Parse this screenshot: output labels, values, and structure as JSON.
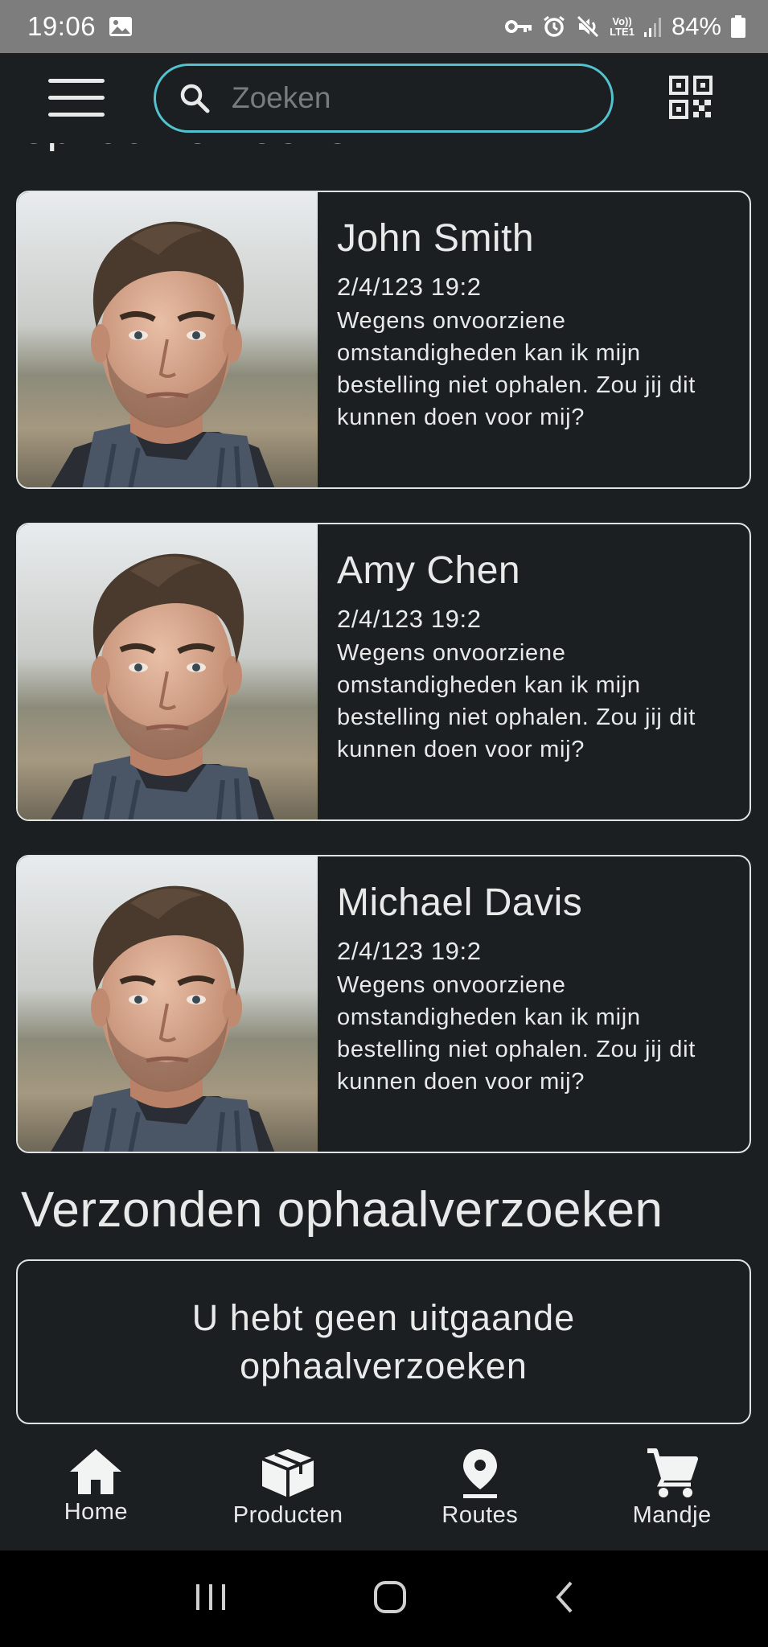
{
  "status_bar": {
    "time": "19:06",
    "battery": "84%",
    "network": "LTE1",
    "volte": "Vo))",
    "icons": [
      "gallery-icon",
      "key-icon",
      "alarm-icon",
      "mute-icon",
      "signal-icon",
      "battery-icon"
    ]
  },
  "app_bar": {
    "search_placeholder": "Zoeken",
    "icons": [
      "menu-icon",
      "search-icon",
      "qr-code-icon"
    ],
    "accent_color": "#52c2cf"
  },
  "received_heading_partial": "ophaalverzoeken",
  "requests": [
    {
      "name": "John Smith",
      "date": "2/4/123 19:2",
      "message": "Wegens onvoorziene omstandigheden kan ik mijn bestelling niet ophalen. Zou jij dit kunnen doen voor mij?"
    },
    {
      "name": "Amy Chen",
      "date": "2/4/123 19:2",
      "message": "Wegens onvoorziene omstandigheden kan ik mijn bestelling niet ophalen. Zou jij dit kunnen doen voor mij?"
    },
    {
      "name": "Michael Davis",
      "date": "2/4/123 19:2",
      "message": "Wegens onvoorziene omstandigheden kan ik mijn bestelling niet ophalen. Zou jij dit kunnen doen voor mij?"
    }
  ],
  "sent_section": {
    "title": "Verzonden ophaalverzoeken",
    "empty_text": "U hebt geen uitgaande ophaalverzoeken"
  },
  "bottom_nav": {
    "items": [
      {
        "label": "Home",
        "icon": "home-icon"
      },
      {
        "label": "Producten",
        "icon": "box-icon"
      },
      {
        "label": "Routes",
        "icon": "location-pin-icon"
      },
      {
        "label": "Mandje",
        "icon": "cart-icon"
      }
    ]
  },
  "system_nav": {
    "icons": [
      "recent-apps-icon",
      "home-circle-icon",
      "back-icon"
    ]
  },
  "colors": {
    "background": "#1b1f21",
    "text": "#e8eaea",
    "status_bar": "#7d7d7d",
    "card_border": "#dfe3e3"
  }
}
